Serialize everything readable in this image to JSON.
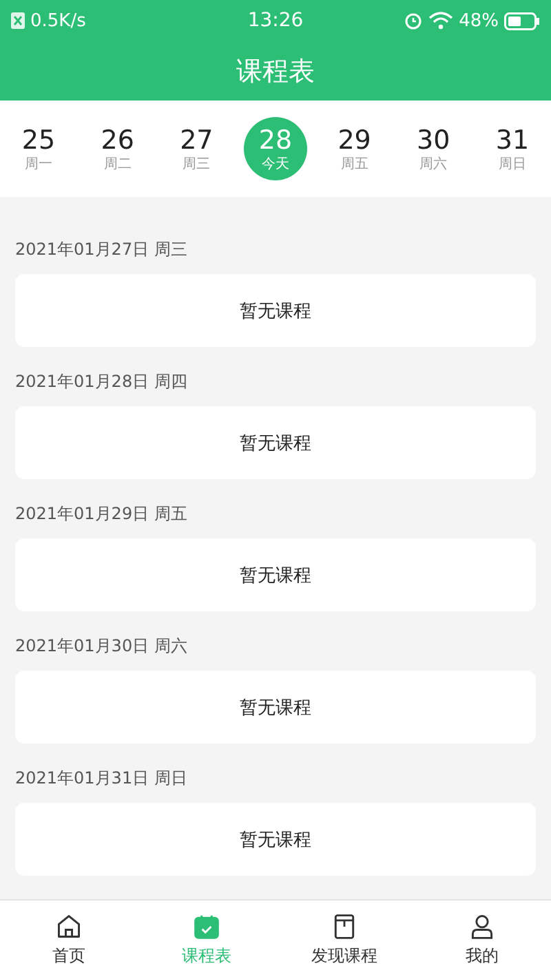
{
  "status_bar": {
    "speed": "0.5K/s",
    "time": "13:26",
    "battery": "48%"
  },
  "header": {
    "title": "课程表"
  },
  "week": [
    {
      "day": "25",
      "label": "周一",
      "selected": false
    },
    {
      "day": "26",
      "label": "周二",
      "selected": false
    },
    {
      "day": "27",
      "label": "周三",
      "selected": false
    },
    {
      "day": "28",
      "label": "今天",
      "selected": true
    },
    {
      "day": "29",
      "label": "周五",
      "selected": false
    },
    {
      "day": "30",
      "label": "周六",
      "selected": false
    },
    {
      "day": "31",
      "label": "周日",
      "selected": false
    }
  ],
  "days": [
    {
      "date": "2021年01月27日  周三",
      "course": "暂无课程"
    },
    {
      "date": "2021年01月28日  周四",
      "course": "暂无课程"
    },
    {
      "date": "2021年01月29日  周五",
      "course": "暂无课程"
    },
    {
      "date": "2021年01月30日  周六",
      "course": "暂无课程"
    },
    {
      "date": "2021年01月31日  周日",
      "course": "暂无课程"
    }
  ],
  "tabbar": [
    {
      "kind": "home",
      "label": "首页",
      "selected": false
    },
    {
      "kind": "calendar",
      "label": "课程表",
      "selected": true
    },
    {
      "kind": "box",
      "label": "发现课程",
      "selected": false
    },
    {
      "kind": "user",
      "label": "我的",
      "selected": false
    }
  ]
}
